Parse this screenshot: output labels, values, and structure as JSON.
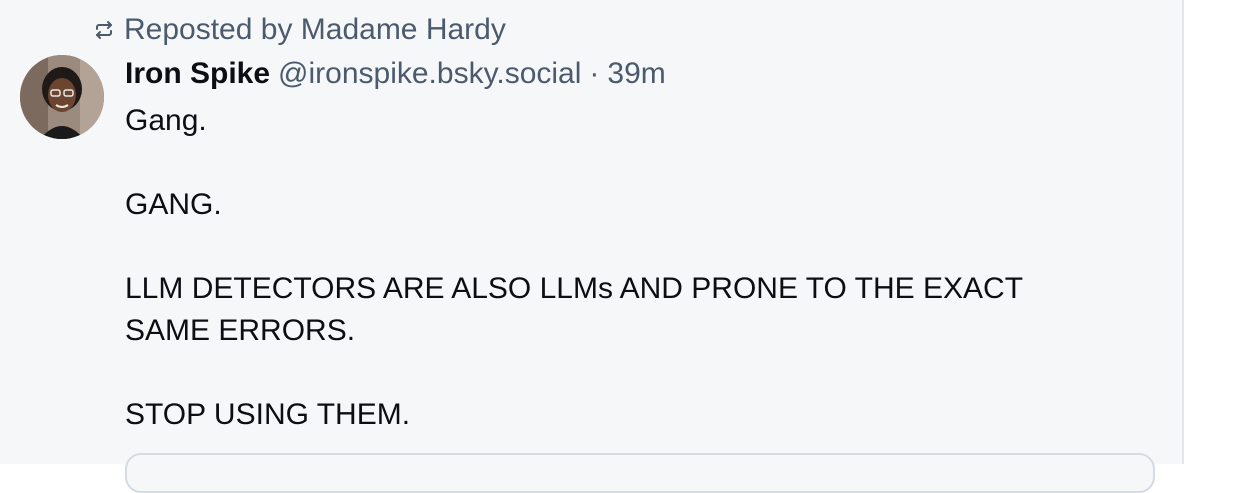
{
  "repost": {
    "icon": "repost-icon",
    "label": "Reposted by Madame Hardy"
  },
  "author": {
    "avatar": "avatar",
    "name": "Iron Spike",
    "handle": "@ironspike.bsky.social",
    "separator": "·",
    "time": "39m"
  },
  "post": {
    "lines": [
      "Gang.",
      "GANG.",
      "LLM DETECTORS ARE ALSO LLMs AND PRONE TO THE EXACT SAME ERRORS.",
      "STOP USING THEM."
    ]
  },
  "colors": {
    "background": "#f6f7f9",
    "text": "#0b0f14",
    "muted": "#4b5a6d",
    "border": "#d6dbe1"
  }
}
